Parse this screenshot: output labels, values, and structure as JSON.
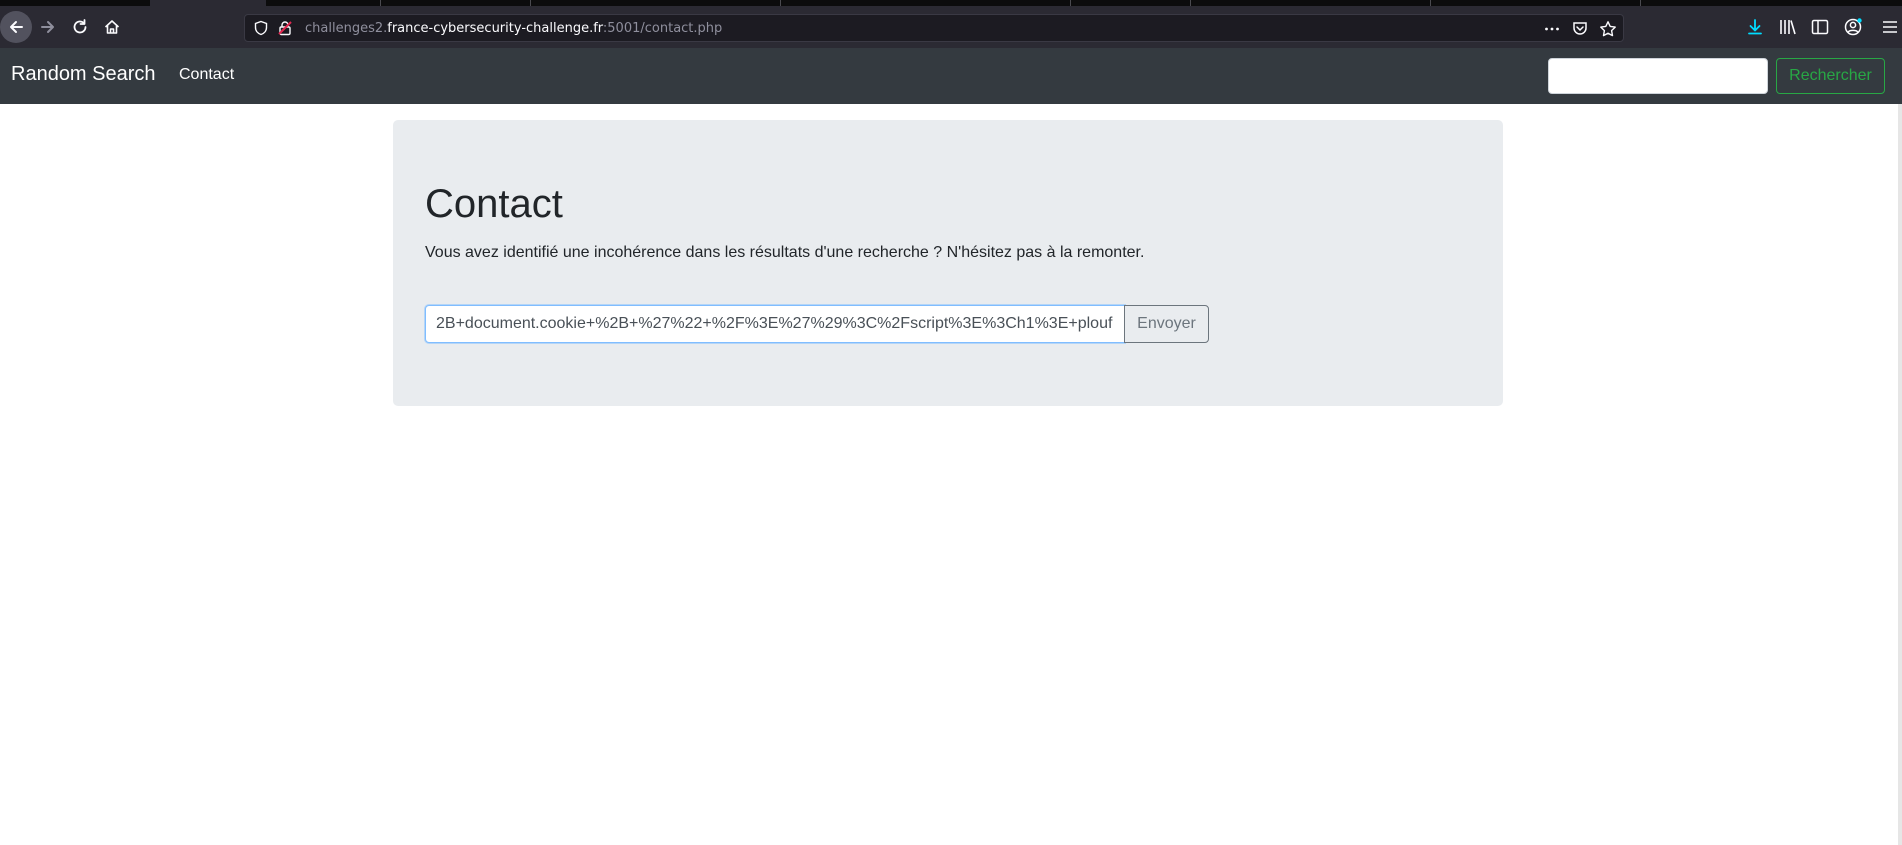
{
  "browser": {
    "url_prefix": "challenges2.",
    "url_host": "france-cybersecurity-challenge.fr",
    "url_suffix": ":5001/contact.php"
  },
  "navbar": {
    "brand": "Random Search",
    "links": [
      "Contact"
    ],
    "search_value": "",
    "search_button": "Rechercher"
  },
  "main": {
    "title": "Contact",
    "lead": "Vous avez identifié une incohérence dans les résultats d'une recherche ? N'hésitez pas à la remonter.",
    "input_value": "2B+document.cookie+%2B+%27%22+%2F%3E%27%29%3C%2Fscript%3E%3Ch1%3E+plouf",
    "submit": "Envoyer"
  },
  "colors": {
    "navbar_bg": "#343a40",
    "jumbotron_bg": "#e9ecef",
    "success": "#28a745",
    "browser_toolbar": "#2b2a33",
    "download_accent": "#0df"
  },
  "icons": [
    "back-arrow-icon",
    "forward-arrow-icon",
    "reload-icon",
    "home-icon",
    "shield-icon",
    "insecure-lock-icon",
    "page-actions-icon",
    "pocket-icon",
    "bookmark-star-icon",
    "downloads-icon",
    "library-icon",
    "sidebar-icon",
    "account-icon",
    "menu-icon"
  ]
}
